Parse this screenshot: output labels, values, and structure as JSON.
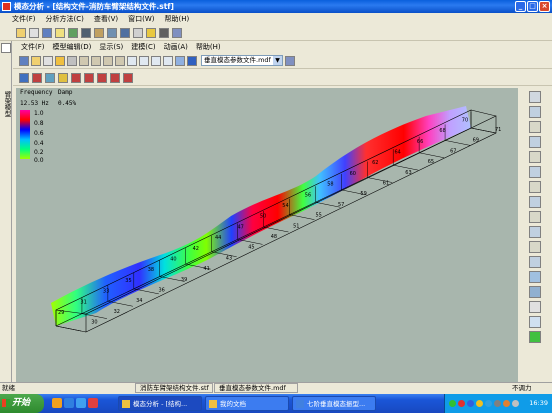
{
  "window": {
    "title": "模态分析 - [结构文件-消防车臂架结构文件.stf]"
  },
  "winbtns": {
    "min": "_",
    "max": "□",
    "close": "×"
  },
  "menu": [
    "文件(F)",
    "分析方法(C)",
    "查看(V)",
    "窗口(W)",
    "帮助(H)"
  ],
  "left_panel": {
    "tab_label": "臂架模型"
  },
  "inner_menu": [
    "文件(F)",
    "模型编辑(D)",
    "显示(S)",
    "建模(C)",
    "动画(A)",
    "帮助(H)"
  ],
  "mode_dropdown": {
    "value": "垂直模态参数文件.mdf",
    "arrow": "▼"
  },
  "overlay": {
    "freq_header": "Frequency",
    "damp_header": "Damp",
    "freq_value": "12.53 Hz",
    "damp_value": "0.45%",
    "legend_ticks": [
      "1.0",
      "0.8",
      "0.6",
      "0.4",
      "0.2",
      "0.0"
    ]
  },
  "node_labels": [
    "29",
    "30",
    "31",
    "32",
    "33",
    "34",
    "35",
    "36",
    "38",
    "39",
    "40",
    "41",
    "42",
    "43",
    "44",
    "45",
    "47",
    "48",
    "50",
    "51",
    "54",
    "55",
    "56",
    "57",
    "58",
    "59",
    "60",
    "61",
    "62",
    "63",
    "64",
    "65",
    "66",
    "67",
    "68",
    "69",
    "70",
    "71"
  ],
  "status": {
    "left": "就绪",
    "file1": "消防车臂架结构文件.stf",
    "file2": "垂直模态参数文件.mdf",
    "right": "不调力"
  },
  "taskbar": {
    "start": "开始",
    "tasks": [
      "模态分析 - [结构...",
      "我的文档",
      "七阶垂直模态振型..."
    ],
    "clock": "16:39"
  },
  "colors": {
    "titlebar": "#0a5fdc",
    "viewport_bg": "#a8b6ad",
    "taskbar": "#1a56d8"
  }
}
